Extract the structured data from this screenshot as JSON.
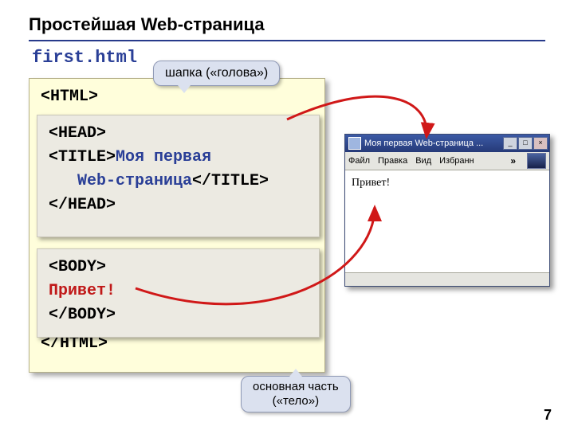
{
  "title": "Простейшая Web-страница",
  "filename": "first.html",
  "code": {
    "html_open": "<HTML>",
    "head_open": "<HEAD>",
    "title_open": "<TITLE>",
    "title_text1": "Моя первая",
    "title_text2_indent": "Web-страница",
    "title_close": "</TITLE>",
    "head_close": "</HEAD>",
    "body_open": "<BODY>",
    "body_text": "Привет!",
    "body_close": "</BODY>",
    "html_close": "</HTML>"
  },
  "callouts": {
    "head": "шапка («голова»)",
    "body_line1": "основная часть",
    "body_line2": "(«тело»)"
  },
  "browser": {
    "title": "Моя первая Web-страница ...",
    "menu": {
      "file": "Файл",
      "edit": "Правка",
      "view": "Вид",
      "fav": "Избранн"
    },
    "chevron": "»",
    "content": "Привет!",
    "btn_min": "_",
    "btn_max": "□",
    "btn_close": "×"
  },
  "page_number": "7"
}
